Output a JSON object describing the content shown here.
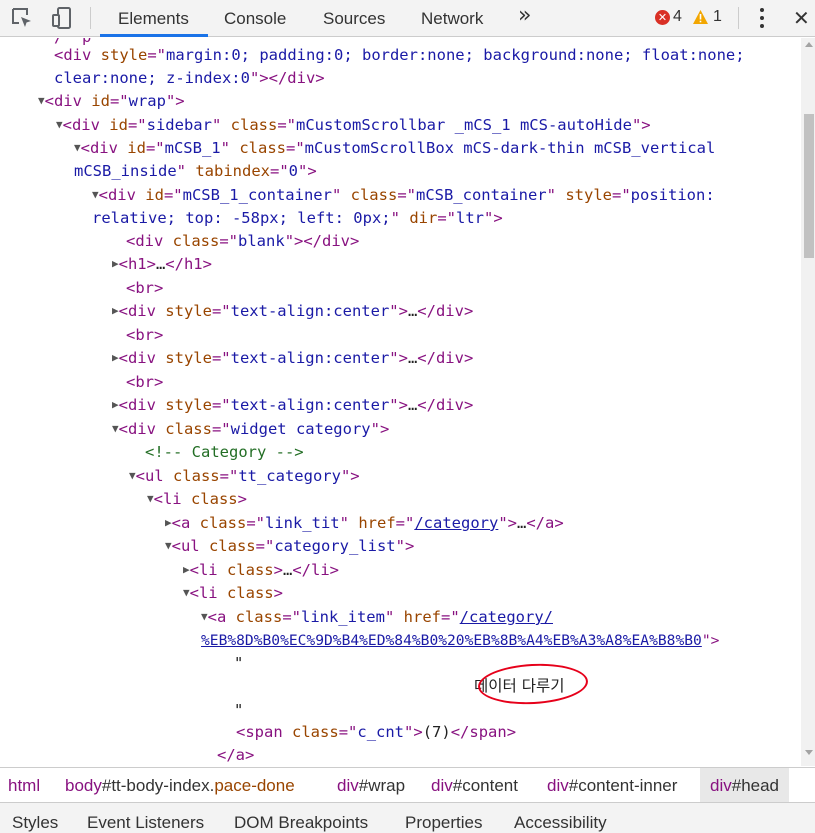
{
  "toolbar": {
    "tabs": [
      "Elements",
      "Console",
      "Sources",
      "Network"
    ],
    "overflow_label": "»",
    "error_count": "4",
    "warning_count": "1",
    "icons": [
      "inspect-element-icon",
      "device-toggle-icon",
      "error-icon",
      "warning-icon",
      "more-options-icon",
      "close-icon"
    ]
  },
  "tree": {
    "l0a_attr_val": "margin:0; padding:0; border:none; background:none; float:none;",
    "l0b_attr_val": "clear:none; z-index:0",
    "wrap_id": "wrap",
    "sidebar_id": "sidebar",
    "sidebar_class": "mCustomScrollbar _mCS_1 mCS-autoHide",
    "mcsb_id": "mCSB_1",
    "mcsb_class_a": "mCustomScrollBox mCS-dark-thin mCSB_vertical",
    "mcsb_class_b": "mCSB_inside",
    "mcsb_tabindex": "0",
    "container_id": "mCSB_1_container",
    "container_class": "mCSB_container",
    "container_style_a": "position:",
    "container_style_b": "relative; top: -58px; left: 0px;",
    "container_dir": "ltr",
    "blank_class": "blank",
    "center_style": "text-align:center",
    "widget_class": "widget category",
    "comment": "<!-- Category -->",
    "ul_class": "tt_category",
    "link_tit_class": "link_tit",
    "link_tit_href": "/category",
    "category_list_class": "category_list",
    "link_item_class": "link_item",
    "link_item_href_a": "/category/",
    "link_item_href_b": "%EB%8D%B0%EC%9D%B4%ED%84%B0%20%EB%8B%A4%EB%A3%A8%EA%B8%B0",
    "quote": "\"",
    "korean_text": "데이터 다루기",
    "cnt_class": "c_cnt",
    "cnt_text": "(7)"
  },
  "breadcrumb": {
    "html": "html",
    "body_tag": "body",
    "body_rest": "#tt-body-index.",
    "body_rest2": "pace-done",
    "wrap_tag": "div",
    "wrap_rest": "#wrap",
    "content_tag": "div",
    "content_rest": "#content",
    "inner_tag": "div",
    "inner_rest": "#content-inner",
    "head_tag": "div",
    "head_rest": "#head"
  },
  "bottom_tabs": [
    "Styles",
    "Event Listeners",
    "DOM Breakpoints",
    "Properties",
    "Accessibility"
  ],
  "colors": {
    "tag": "#881280",
    "attr_name": "#994500",
    "attr_value": "#1a1aa6",
    "comment": "#236e25",
    "accent": "#1a73e8",
    "annotation": "#e6001a"
  }
}
